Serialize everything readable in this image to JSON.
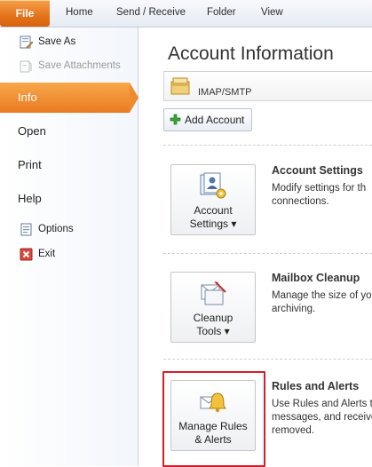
{
  "ribbon": {
    "tabs": [
      "File",
      "Home",
      "Send / Receive",
      "Folder",
      "View"
    ]
  },
  "nav": {
    "save_as": "Save As",
    "save_attachments": "Save Attachments",
    "info": "Info",
    "open": "Open",
    "print": "Print",
    "help": "Help",
    "options": "Options",
    "exit": "Exit"
  },
  "main": {
    "title": "Account Information",
    "account_type": "IMAP/SMTP",
    "add_account": "Add Account",
    "sections": [
      {
        "button": "Account\nSettings ▾",
        "title": "Account Settings",
        "desc": [
          "Modify settings for th",
          "connections."
        ]
      },
      {
        "button": "Cleanup\nTools ▾",
        "title": "Mailbox Cleanup",
        "desc": [
          "Manage the size of yo",
          "archiving."
        ]
      },
      {
        "button": "Manage Rules\n& Alerts",
        "title": "Rules and Alerts",
        "desc": [
          "Use Rules and Alerts t",
          "messages, and receive",
          "removed."
        ]
      }
    ]
  },
  "colors": {
    "file_tab": "#e3731b",
    "info_selected": "#ea7a22",
    "highlight_box": "#d11f2a"
  }
}
